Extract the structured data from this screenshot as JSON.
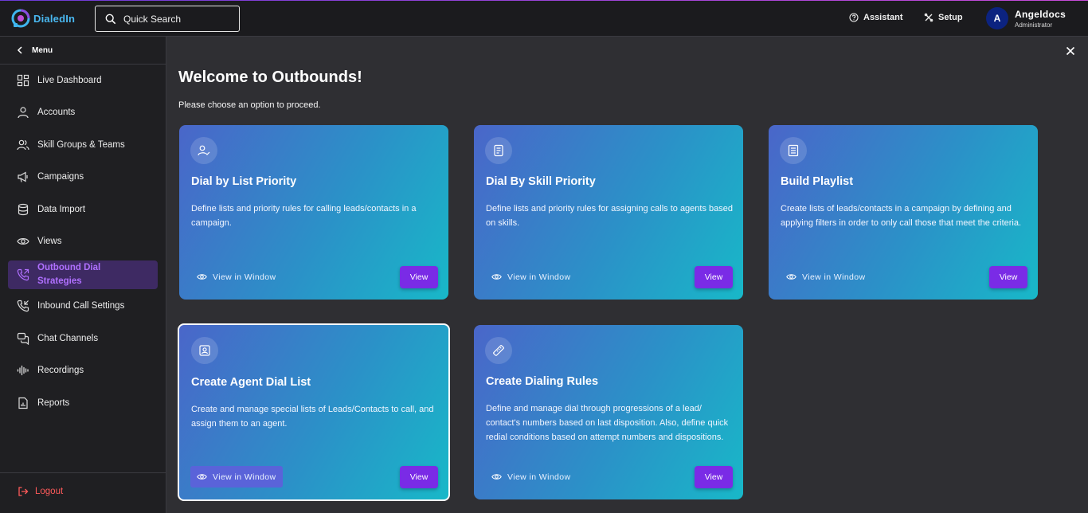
{
  "app": {
    "logo_text": "DialedIn"
  },
  "search": {
    "placeholder": "Quick Search"
  },
  "topbar": {
    "assistant_label": "Assistant",
    "setup_label": "Setup",
    "user": {
      "initial": "A",
      "name": "Angeldocs",
      "role": "Administrator"
    }
  },
  "sidebar": {
    "menu_label": "Menu",
    "items": [
      {
        "label": "Live Dashboard",
        "icon": "dashboard-icon"
      },
      {
        "label": "Accounts",
        "icon": "user-icon"
      },
      {
        "label": "Skill Groups & Teams",
        "icon": "users-icon"
      },
      {
        "label": "Campaigns",
        "icon": "megaphone-icon"
      },
      {
        "label": "Data Import",
        "icon": "database-icon"
      },
      {
        "label": "Views",
        "icon": "eye-icon"
      },
      {
        "label": "Outbound Dial Strategies",
        "icon": "phone-outgoing-icon",
        "active": true
      },
      {
        "label": "Inbound Call Settings",
        "icon": "phone-incoming-icon"
      },
      {
        "label": "Chat Channels",
        "icon": "chat-icon"
      },
      {
        "label": "Recordings",
        "icon": "waveform-icon"
      },
      {
        "label": "Reports",
        "icon": "report-icon"
      }
    ],
    "logout_label": "Logout"
  },
  "main": {
    "title": "Welcome to Outbounds!",
    "subtitle": "Please choose an option to proceed.",
    "cards": [
      {
        "title": "Dial by List Priority",
        "description": "Define lists and priority rules for calling leads/contacts in a campaign.",
        "view_window_label": "View in Window",
        "view_label": "View",
        "icon": "user-check-icon"
      },
      {
        "title": "Dial By Skill Priority",
        "description": "Define lists and priority rules for assigning calls to agents based on skills.",
        "view_window_label": "View in Window",
        "view_label": "View",
        "icon": "document-icon"
      },
      {
        "title": "Build Playlist",
        "description": "Create lists of leads/contacts in a campaign by defining and applying filters in order to only call those that meet the criteria.",
        "view_window_label": "View in Window",
        "view_label": "View",
        "icon": "list-icon"
      },
      {
        "title": "Create Agent Dial List",
        "description": "Create and manage special lists of Leads/Contacts to call, and assign them to an agent.",
        "view_window_label": "View in Window",
        "view_label": "View",
        "icon": "contact-card-icon",
        "selected": true
      },
      {
        "title": "Create Dialing Rules",
        "description": "Define and manage dial through progressions of a lead/ contact's numbers based on last disposition. Also, define quick redial conditions based on attempt numbers and dispositions.",
        "view_window_label": "View in Window",
        "view_label": "View",
        "icon": "ruler-icon"
      }
    ]
  },
  "colors": {
    "accent": "#7a2be6",
    "active_nav_bg": "#3e2a63",
    "active_nav_text": "#b070ff",
    "logout": "#ff5a5a"
  }
}
